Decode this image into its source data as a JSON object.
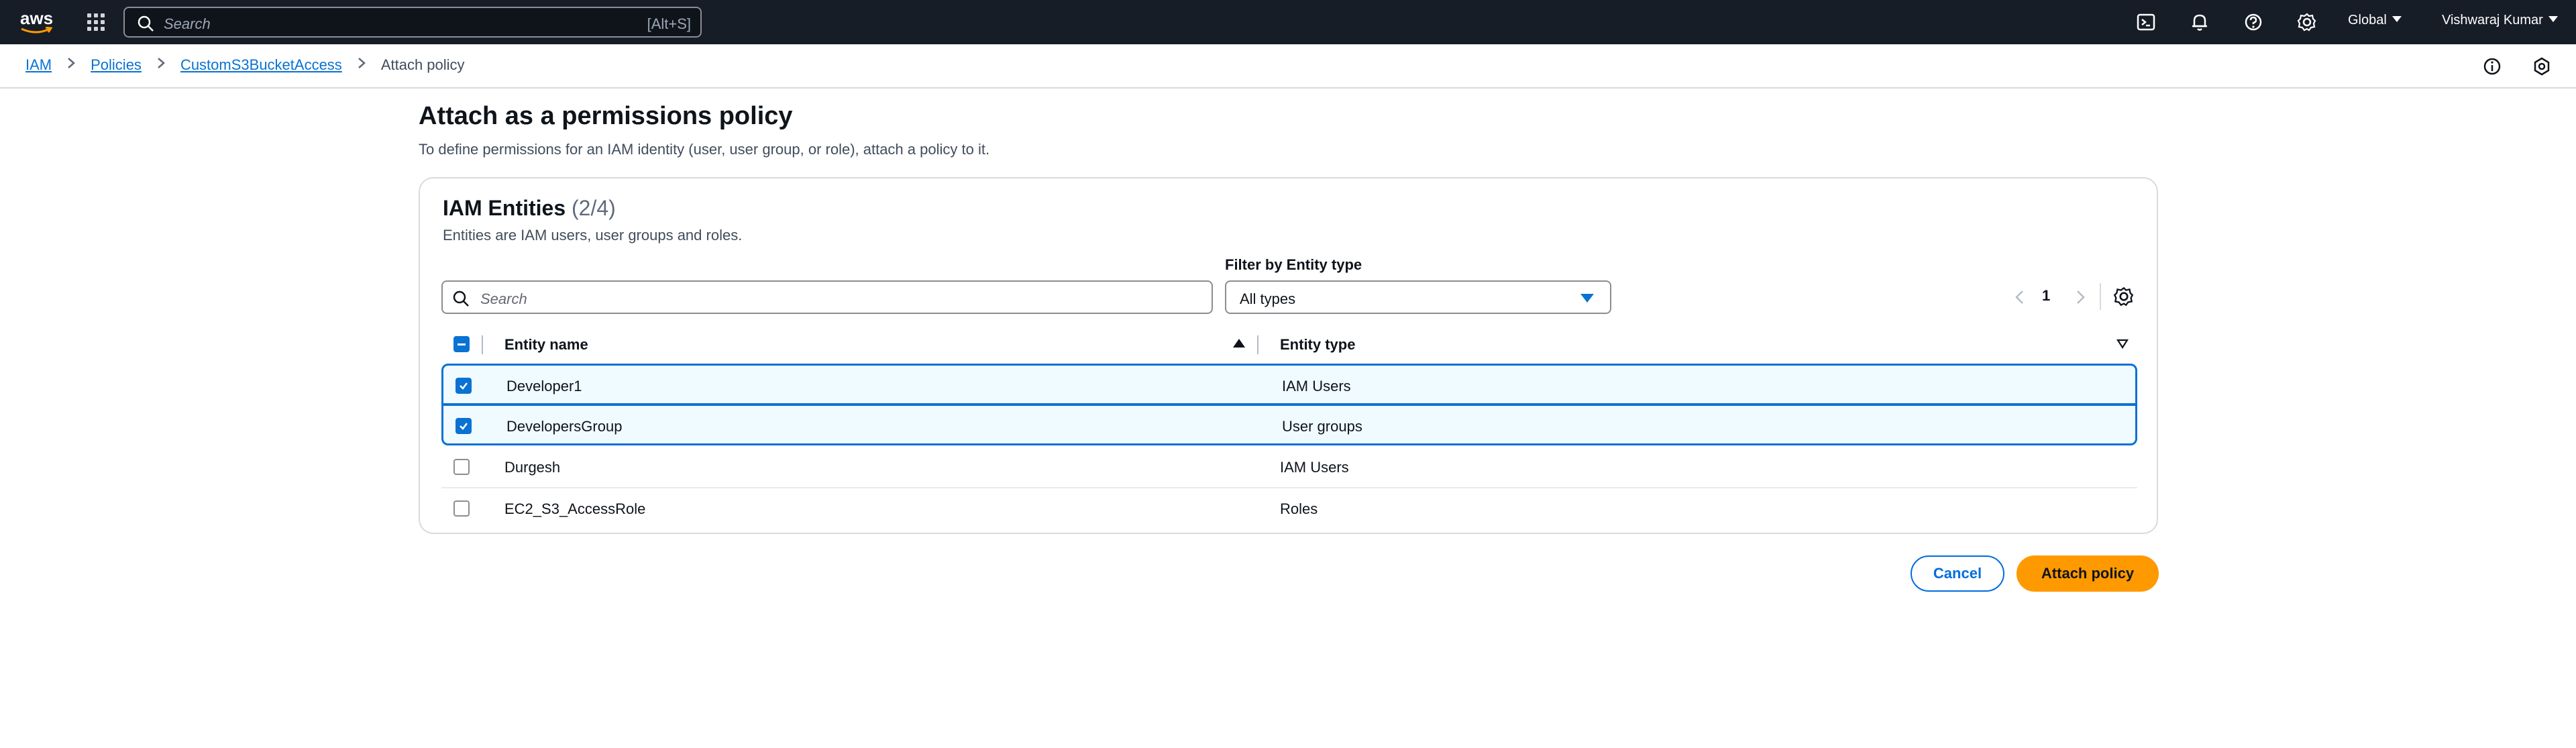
{
  "topnav": {
    "logo_text": "aws",
    "search_placeholder": "Search",
    "search_shortcut": "[Alt+S]",
    "region": "Global",
    "user": "Vishwaraj Kumar"
  },
  "breadcrumb": {
    "items": [
      "IAM",
      "Policies",
      "CustomS3BucketAccess"
    ],
    "current": "Attach policy"
  },
  "page": {
    "title": "Attach as a permissions policy",
    "description": "To define permissions for an IAM identity (user, user group, or role), attach a policy to it."
  },
  "entities": {
    "title": "IAM Entities",
    "count": "(2/4)",
    "description": "Entities are IAM users, user groups and roles.",
    "search_placeholder": "Search",
    "filter_label": "Filter by Entity type",
    "filter_value": "All types",
    "page_number": "1",
    "columns": [
      "Entity name",
      "Entity type"
    ],
    "rows": [
      {
        "name": "Developer1",
        "type": "IAM Users",
        "selected": true
      },
      {
        "name": "DevelopersGroup",
        "type": "User groups",
        "selected": true
      },
      {
        "name": "Durgesh",
        "type": "IAM Users",
        "selected": false
      },
      {
        "name": "EC2_S3_AccessRole",
        "type": "Roles",
        "selected": false
      }
    ]
  },
  "actions": {
    "cancel": "Cancel",
    "attach": "Attach policy"
  },
  "colors": {
    "nav_bg": "#161d26",
    "link": "#0972d3",
    "primary_button": "#ff9900",
    "selected_row_bg": "#f0fbff"
  }
}
